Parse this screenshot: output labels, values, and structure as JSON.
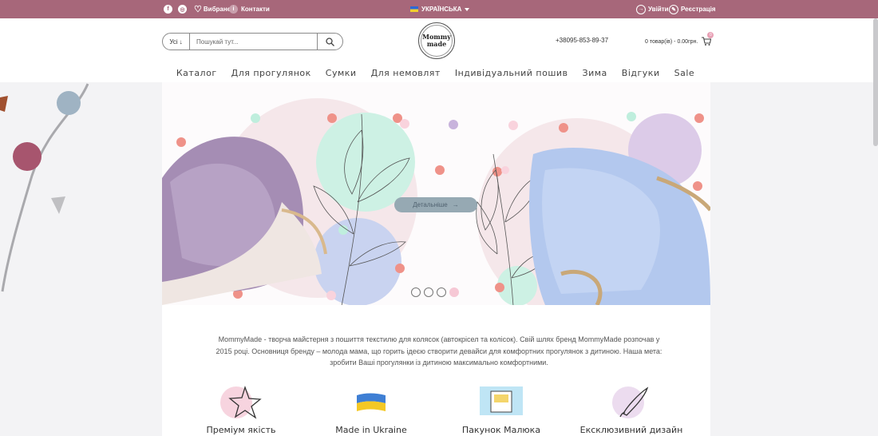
{
  "topbar": {
    "social": [
      "facebook-icon",
      "instagram-icon"
    ],
    "favorites": "Вибране",
    "contacts": "Контакти",
    "language": "УКРАЇНСЬКА",
    "login": "Увійти",
    "register": "Реєстрація"
  },
  "header": {
    "search_category": "Усі",
    "search_placeholder": "Пошукай тут...",
    "logo_line1": "Mommy",
    "logo_line2": "made",
    "phone": "+38095-853-89-37",
    "cart_text": "0 товар(ів) - 0.00грн.",
    "cart_count": "0"
  },
  "nav": [
    "Каталог",
    "Для прогулянок",
    "Сумки",
    "Для немовлят",
    "Індивідуальний пошив",
    "Зима",
    "Відгуки",
    "Sale"
  ],
  "hero": {
    "cta": "Детальніше",
    "slides": 4,
    "active_slide": 3
  },
  "about": "MommyMade - творча майстерня з пошиття текстилю для колясок (автокрісел та колісок). Свій шлях бренд MommyMade розпочав у 2015 році. Основниця бренду – молода мама, що горить ідеєю створити девайси для комфортних прогулянок з дитиною. Наша мета: зробити Ваші прогулянки із дитиною максимально комфортними.",
  "features": [
    {
      "label": "Преміум якість",
      "icon": "star-icon"
    },
    {
      "label": "Made in Ukraine",
      "icon": "ukraine-flag-icon"
    },
    {
      "label": "Пакунок Малюка",
      "icon": "package-icon"
    },
    {
      "label": "Ексклюзивний дизайн",
      "icon": "brush-icon"
    }
  ],
  "colors": {
    "topbar": "#a7677a",
    "accent": "#f6c8d5",
    "mint": "#bfeedd",
    "lavender": "#d9c6e6"
  }
}
